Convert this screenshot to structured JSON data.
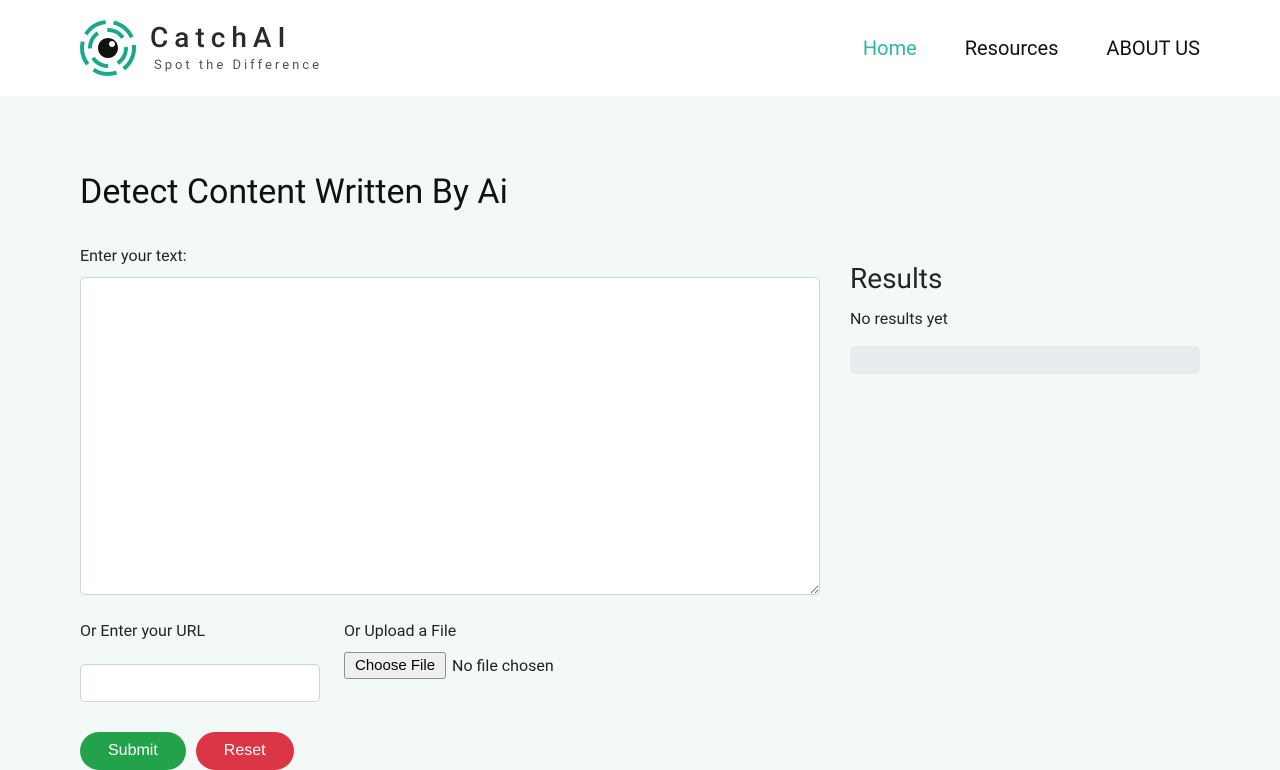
{
  "brand": {
    "name": "CatchAI",
    "tagline": "Spot the Difference"
  },
  "nav": {
    "home": "Home",
    "resources": "Resources",
    "about": "ABOUT US"
  },
  "main": {
    "title": "Detect Content Written By Ai",
    "text_label": "Enter your text:",
    "url_label": "Or Enter your URL",
    "file_label": "Or Upload a File",
    "choose_file": "Choose File",
    "file_status": "No file chosen",
    "submit": "Submit",
    "reset": "Reset"
  },
  "results": {
    "title": "Results",
    "message": "No results yet"
  }
}
